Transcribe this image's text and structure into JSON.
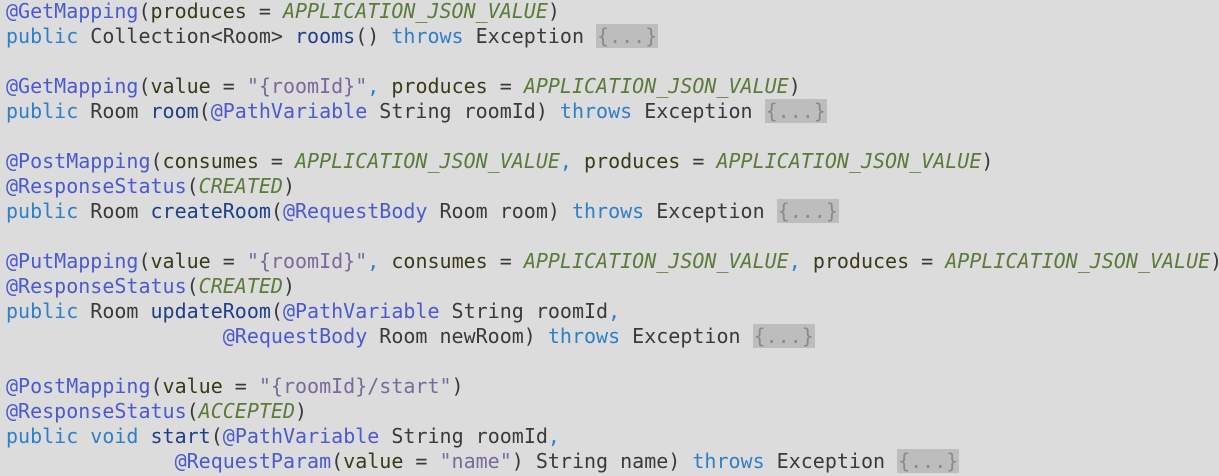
{
  "colors": {
    "background": "#dcdcdc",
    "annotation": "#4b5ad0",
    "keyword": "#2f7fc8",
    "method_name": "#1d3f8a",
    "constant": "#5c7a3a",
    "string": "#7a6a9a",
    "fold_background": "#bdbdbd"
  },
  "lines": [
    [
      {
        "c": "ann",
        "t": "@GetMapping"
      },
      {
        "c": "plain",
        "t": "("
      },
      {
        "c": "param",
        "t": "produces"
      },
      {
        "c": "plain",
        "t": " = "
      },
      {
        "c": "const",
        "t": "APPLICATION_JSON_VALUE"
      },
      {
        "c": "plain",
        "t": ")"
      }
    ],
    [
      {
        "c": "kw",
        "t": "public"
      },
      {
        "c": "plain",
        "t": " Collection<Room> "
      },
      {
        "c": "mname",
        "t": "rooms"
      },
      {
        "c": "plain",
        "t": "() "
      },
      {
        "c": "kw",
        "t": "throws"
      },
      {
        "c": "plain",
        "t": " Exception "
      },
      {
        "c": "fold",
        "t": "{...}"
      }
    ],
    [],
    [
      {
        "c": "ann",
        "t": "@GetMapping"
      },
      {
        "c": "plain",
        "t": "("
      },
      {
        "c": "param",
        "t": "value"
      },
      {
        "c": "plain",
        "t": " = "
      },
      {
        "c": "str",
        "t": "\"{roomId}\""
      },
      {
        "c": "kw",
        "t": ","
      },
      {
        "c": "plain",
        "t": " "
      },
      {
        "c": "param",
        "t": "produces"
      },
      {
        "c": "plain",
        "t": " = "
      },
      {
        "c": "const",
        "t": "APPLICATION_JSON_VALUE"
      },
      {
        "c": "plain",
        "t": ")"
      }
    ],
    [
      {
        "c": "kw",
        "t": "public"
      },
      {
        "c": "plain",
        "t": " Room "
      },
      {
        "c": "mname",
        "t": "room"
      },
      {
        "c": "plain",
        "t": "("
      },
      {
        "c": "ann",
        "t": "@PathVariable"
      },
      {
        "c": "plain",
        "t": " String roomId) "
      },
      {
        "c": "kw",
        "t": "throws"
      },
      {
        "c": "plain",
        "t": " Exception "
      },
      {
        "c": "fold",
        "t": "{...}"
      }
    ],
    [],
    [
      {
        "c": "ann",
        "t": "@PostMapping"
      },
      {
        "c": "plain",
        "t": "("
      },
      {
        "c": "param",
        "t": "consumes"
      },
      {
        "c": "plain",
        "t": " = "
      },
      {
        "c": "const",
        "t": "APPLICATION_JSON_VALUE"
      },
      {
        "c": "kw",
        "t": ","
      },
      {
        "c": "plain",
        "t": " "
      },
      {
        "c": "param",
        "t": "produces"
      },
      {
        "c": "plain",
        "t": " = "
      },
      {
        "c": "const",
        "t": "APPLICATION_JSON_VALUE"
      },
      {
        "c": "plain",
        "t": ")"
      }
    ],
    [
      {
        "c": "ann",
        "t": "@ResponseStatus"
      },
      {
        "c": "plain",
        "t": "("
      },
      {
        "c": "const",
        "t": "CREATED"
      },
      {
        "c": "plain",
        "t": ")"
      }
    ],
    [
      {
        "c": "kw",
        "t": "public"
      },
      {
        "c": "plain",
        "t": " Room "
      },
      {
        "c": "mname",
        "t": "createRoom"
      },
      {
        "c": "plain",
        "t": "("
      },
      {
        "c": "ann",
        "t": "@RequestBody"
      },
      {
        "c": "plain",
        "t": " Room room) "
      },
      {
        "c": "kw",
        "t": "throws"
      },
      {
        "c": "plain",
        "t": " Exception "
      },
      {
        "c": "fold",
        "t": "{...}"
      }
    ],
    [],
    [
      {
        "c": "ann",
        "t": "@PutMapping"
      },
      {
        "c": "plain",
        "t": "("
      },
      {
        "c": "param",
        "t": "value"
      },
      {
        "c": "plain",
        "t": " = "
      },
      {
        "c": "str",
        "t": "\"{roomId}\""
      },
      {
        "c": "kw",
        "t": ","
      },
      {
        "c": "plain",
        "t": " "
      },
      {
        "c": "param",
        "t": "consumes"
      },
      {
        "c": "plain",
        "t": " = "
      },
      {
        "c": "const",
        "t": "APPLICATION_JSON_VALUE"
      },
      {
        "c": "kw",
        "t": ","
      },
      {
        "c": "plain",
        "t": " "
      },
      {
        "c": "param",
        "t": "produces"
      },
      {
        "c": "plain",
        "t": " = "
      },
      {
        "c": "const",
        "t": "APPLICATION_JSON_VALUE"
      },
      {
        "c": "plain",
        "t": ")"
      }
    ],
    [
      {
        "c": "ann",
        "t": "@ResponseStatus"
      },
      {
        "c": "plain",
        "t": "("
      },
      {
        "c": "const",
        "t": "CREATED"
      },
      {
        "c": "plain",
        "t": ")"
      }
    ],
    [
      {
        "c": "kw",
        "t": "public"
      },
      {
        "c": "plain",
        "t": " Room "
      },
      {
        "c": "mname",
        "t": "updateRoom"
      },
      {
        "c": "plain",
        "t": "("
      },
      {
        "c": "ann",
        "t": "@PathVariable"
      },
      {
        "c": "plain",
        "t": " String roomId"
      },
      {
        "c": "kw",
        "t": ","
      }
    ],
    [
      {
        "c": "plain",
        "t": "                  "
      },
      {
        "c": "ann",
        "t": "@RequestBody"
      },
      {
        "c": "plain",
        "t": " Room newRoom) "
      },
      {
        "c": "kw",
        "t": "throws"
      },
      {
        "c": "plain",
        "t": " Exception "
      },
      {
        "c": "fold",
        "t": "{...}"
      }
    ],
    [],
    [
      {
        "c": "ann",
        "t": "@PostMapping"
      },
      {
        "c": "plain",
        "t": "("
      },
      {
        "c": "param",
        "t": "value"
      },
      {
        "c": "plain",
        "t": " = "
      },
      {
        "c": "str",
        "t": "\"{roomId}/start\""
      },
      {
        "c": "plain",
        "t": ")"
      }
    ],
    [
      {
        "c": "ann",
        "t": "@ResponseStatus"
      },
      {
        "c": "plain",
        "t": "("
      },
      {
        "c": "const",
        "t": "ACCEPTED"
      },
      {
        "c": "plain",
        "t": ")"
      }
    ],
    [
      {
        "c": "kw",
        "t": "public"
      },
      {
        "c": "plain",
        "t": " "
      },
      {
        "c": "kw",
        "t": "void"
      },
      {
        "c": "plain",
        "t": " "
      },
      {
        "c": "mname",
        "t": "start"
      },
      {
        "c": "plain",
        "t": "("
      },
      {
        "c": "ann",
        "t": "@PathVariable"
      },
      {
        "c": "plain",
        "t": " String roomId"
      },
      {
        "c": "kw",
        "t": ","
      }
    ],
    [
      {
        "c": "plain",
        "t": "              "
      },
      {
        "c": "ann",
        "t": "@RequestParam"
      },
      {
        "c": "plain",
        "t": "("
      },
      {
        "c": "param",
        "t": "value"
      },
      {
        "c": "plain",
        "t": " = "
      },
      {
        "c": "str",
        "t": "\"name\""
      },
      {
        "c": "plain",
        "t": ") String name) "
      },
      {
        "c": "kw",
        "t": "throws"
      },
      {
        "c": "plain",
        "t": " Exception "
      },
      {
        "c": "fold",
        "t": "{...}"
      }
    ]
  ]
}
